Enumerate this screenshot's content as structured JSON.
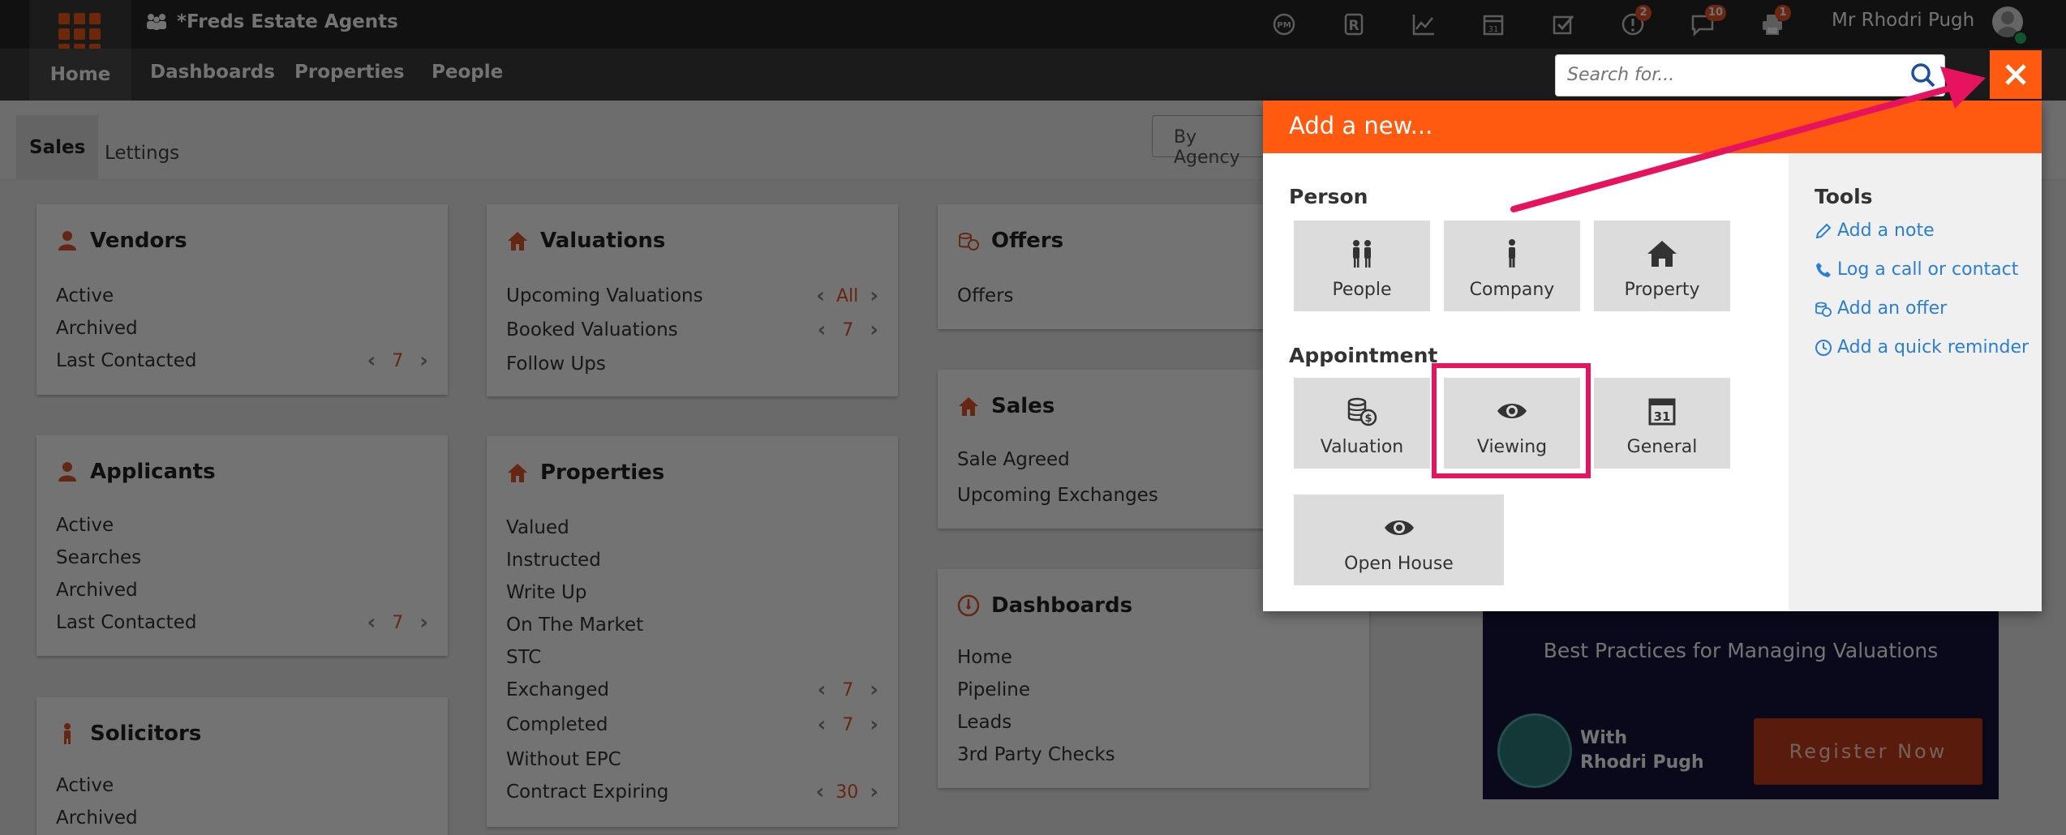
{
  "app": {
    "brand": "*Freds Estate Agents",
    "user_name": "Mr Rhodri Pugh"
  },
  "top_icons": [
    {
      "name": "pm-sync-icon",
      "badge": ""
    },
    {
      "name": "r-logo-icon",
      "badge": ""
    },
    {
      "name": "chart-icon",
      "badge": ""
    },
    {
      "name": "calendar-icon",
      "badge": ""
    },
    {
      "name": "checklist-icon",
      "badge": ""
    },
    {
      "name": "alert-icon",
      "badge": "2"
    },
    {
      "name": "chat-icon",
      "badge": "10"
    },
    {
      "name": "printer-icon",
      "badge": "1"
    }
  ],
  "nav": {
    "home": "Home",
    "dashboards": "Dashboards",
    "properties": "Properties",
    "people": "People"
  },
  "search": {
    "placeholder": "Search for..."
  },
  "subtabs": {
    "sales": "Sales",
    "lettings": "Lettings",
    "by_agency": "By Agency"
  },
  "vendors": {
    "title": "Vendors",
    "rows": [
      "Active",
      "Archived",
      "Last Contacted"
    ],
    "last_contacted_value": "7"
  },
  "applicants": {
    "title": "Applicants",
    "rows": [
      "Active",
      "Searches",
      "Archived",
      "Last Contacted"
    ],
    "last_contacted_value": "7"
  },
  "solicitors": {
    "title": "Solicitors",
    "rows": [
      "Active",
      "Archived"
    ]
  },
  "valuations": {
    "title": "Valuations",
    "rows": [
      "Upcoming Valuations",
      "Booked Valuations",
      "Follow Ups"
    ],
    "upcoming_value": "All",
    "booked_value": "7"
  },
  "properties": {
    "title": "Properties",
    "rows": [
      "Valued",
      "Instructed",
      "Write Up",
      "On The Market",
      "STC",
      "Exchanged",
      "Completed",
      "Without EPC",
      "Contract Expiring"
    ],
    "exchanged_value": "7",
    "completed_value": "7",
    "expiring_value": "30"
  },
  "offers": {
    "title": "Offers",
    "rows": [
      "Offers"
    ]
  },
  "sales": {
    "title": "Sales",
    "rows": [
      "Sale Agreed",
      "Upcoming Exchanges"
    ]
  },
  "dashboards": {
    "title": "Dashboards",
    "rows": [
      "Home",
      "Pipeline",
      "Leads",
      "3rd Party Checks"
    ]
  },
  "promo": {
    "title": "Best Practices for Managing Valuations",
    "with": "With",
    "presenter": "Rhodri Pugh",
    "register": "Register Now"
  },
  "add_panel": {
    "header": "Add a new...",
    "person_label": "Person",
    "person_tiles": [
      "People",
      "Company",
      "Property"
    ],
    "appointment_label": "Appointment",
    "appointment_tiles": [
      "Valuation",
      "Viewing",
      "General",
      "Open House"
    ],
    "tools_label": "Tools",
    "tools": [
      "Add a note",
      "Log a call or contact",
      "Add an offer",
      "Add a quick reminder"
    ]
  },
  "colors": {
    "accent": "#ff5a0f",
    "highlight": "#e8135f",
    "link": "#2a7fd4",
    "topbar": "#262626",
    "navbar": "#3d3d3d"
  }
}
